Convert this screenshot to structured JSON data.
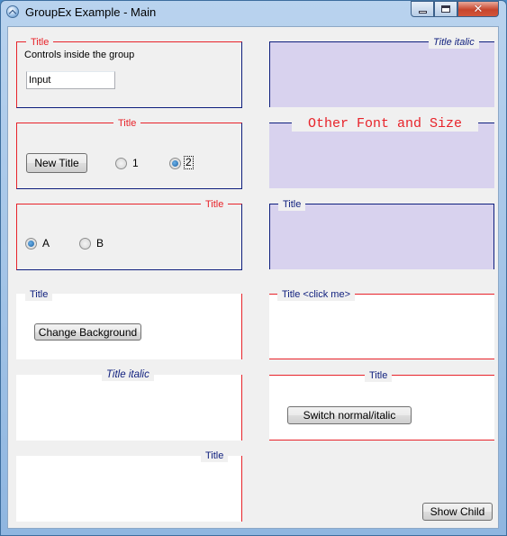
{
  "window": {
    "title": "GroupEx Example - Main",
    "icon": "app-icon"
  },
  "colors": {
    "red": "#e8232a",
    "navy": "#0e1e7d",
    "lavender": "#d8d2ee",
    "white": "#ffffff",
    "face": "#f0f0f0"
  },
  "groups": {
    "g1": {
      "title": "Title",
      "text": "Controls inside the group",
      "input_value": "Input"
    },
    "g2": {
      "title": "Title",
      "button": "New Title",
      "radio1": "1",
      "radio2": "2",
      "selected": "2"
    },
    "g3": {
      "title": "Title",
      "radioA": "A",
      "radioB": "B",
      "selected": "A"
    },
    "g4": {
      "title": "Title",
      "button": "Change Background"
    },
    "g5": {
      "title": "Title italic"
    },
    "g6": {
      "title": "Title"
    },
    "r1": {
      "title": "Title italic"
    },
    "r2": {
      "title": "Other Font and Size"
    },
    "r3": {
      "title": "Title"
    },
    "r4": {
      "title": "Title <click me>"
    },
    "r5": {
      "title": "Title",
      "button": "Switch normal/italic"
    }
  },
  "footer": {
    "show_child": "Show Child"
  }
}
